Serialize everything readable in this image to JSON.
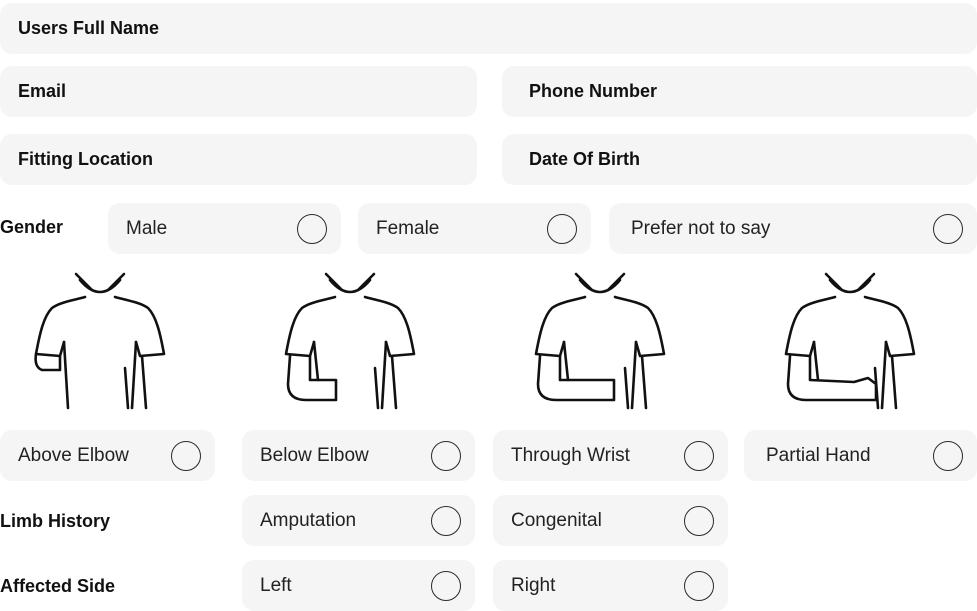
{
  "fields": {
    "full_name": {
      "placeholder": "Users Full Name"
    },
    "email": {
      "placeholder": "Email"
    },
    "phone": {
      "placeholder": "Phone Number"
    },
    "fitting_location": {
      "placeholder": "Fitting Location"
    },
    "dob": {
      "placeholder": "Date Of Birth"
    }
  },
  "gender": {
    "label": "Gender",
    "options": [
      {
        "label": "Male",
        "selected": false
      },
      {
        "label": "Female",
        "selected": false
      },
      {
        "label": "Prefer not to say",
        "selected": false
      }
    ]
  },
  "amputation_level": {
    "options": [
      {
        "label": "Above Elbow",
        "icon": "torso-above-elbow-icon",
        "selected": false
      },
      {
        "label": "Below Elbow",
        "icon": "torso-below-elbow-icon",
        "selected": false
      },
      {
        "label": "Through Wrist",
        "icon": "torso-through-wrist-icon",
        "selected": false
      },
      {
        "label": "Partial Hand",
        "icon": "torso-partial-hand-icon",
        "selected": false
      }
    ]
  },
  "limb_history": {
    "label": "Limb History",
    "options": [
      {
        "label": "Amputation",
        "selected": false
      },
      {
        "label": "Congenital",
        "selected": false
      }
    ]
  },
  "affected_side": {
    "label": "Affected Side",
    "options": [
      {
        "label": "Left",
        "selected": false
      },
      {
        "label": "Right",
        "selected": false
      }
    ]
  },
  "colors": {
    "field_bg": "#f5f5f5",
    "text": "#111111",
    "radio_border": "#2a2a2a"
  }
}
